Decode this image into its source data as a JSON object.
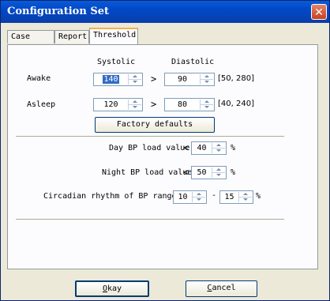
{
  "window": {
    "title": "Configuration Set",
    "close_glyph": "✕"
  },
  "tabs": [
    {
      "label": "Case Path"
    },
    {
      "label": "Report"
    },
    {
      "label": "Threshold"
    }
  ],
  "threshold": {
    "col_systolic": "Systolic",
    "col_diastolic": "Diastolic",
    "awake": {
      "label": "Awake",
      "systolic": "140",
      "diastolic": "90",
      "range": "[50, 280]",
      "gt": ">"
    },
    "asleep": {
      "label": "Asleep",
      "systolic": "120",
      "diastolic": "80",
      "range": "[40, 240]",
      "gt": ">"
    },
    "factory_defaults_label": "Factory defaults",
    "day_load": {
      "label": "Day BP load value",
      "lt": "<",
      "value": "40",
      "unit": "%"
    },
    "night_load": {
      "label": "Night BP load value",
      "lt": "<",
      "value": "50",
      "unit": "%"
    },
    "circadian": {
      "label": "Circadian rhythm of BP ranges",
      "min": "10",
      "dash": "-",
      "max": "15",
      "unit": "%"
    }
  },
  "footer": {
    "ok_first": "O",
    "ok_rest": "kay",
    "cancel_first": "C",
    "cancel_rest": "ancel"
  },
  "colors": {
    "titlebar": "#0048c8",
    "close": "#c8401e",
    "tab_accent": "#f7b04c"
  }
}
